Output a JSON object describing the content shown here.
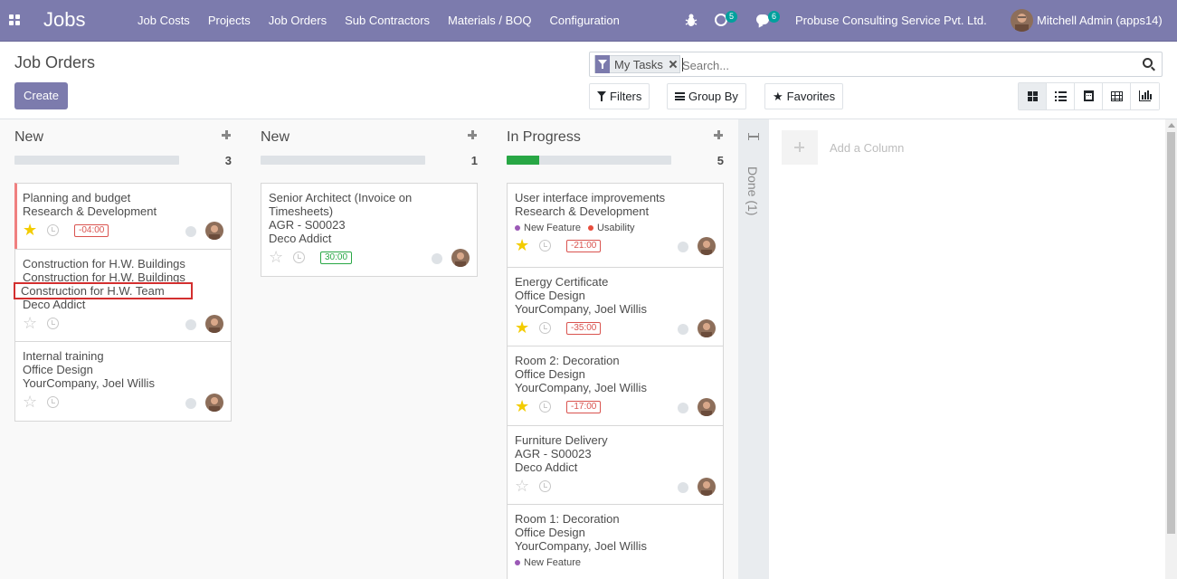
{
  "navbar": {
    "app_name": "Jobs",
    "menu": [
      "Job Costs",
      "Projects",
      "Job Orders",
      "Sub Contractors",
      "Materials / BOQ",
      "Configuration"
    ],
    "activity_count": "5",
    "message_count": "6",
    "company": "Probuse Consulting Service Pvt. Ltd.",
    "user": "Mitchell Admin (apps14)"
  },
  "control_panel": {
    "breadcrumb": "Job Orders",
    "create_label": "Create",
    "facet_label": "My Tasks",
    "search_placeholder": "Search...",
    "filters_label": "Filters",
    "groupby_label": "Group By",
    "favorites_label": "Favorites"
  },
  "columns": [
    {
      "title": "New",
      "count": "3",
      "progress_done": 0,
      "cards": [
        {
          "lines": [
            "Planning and budget",
            "Research & Development"
          ],
          "starred": true,
          "hours": "-04:00",
          "hours_state": "neg",
          "red_edge": true
        },
        {
          "lines": [
            "Construction for H.W. Buildings",
            "Construction for H.W. Buildings",
            "Construction for H.W. Team",
            "Deco Addict"
          ],
          "starred": false,
          "hours": "",
          "highlight_line": 2
        },
        {
          "lines": [
            "Internal training",
            "Office Design",
            "YourCompany, Joel Willis"
          ],
          "starred": false,
          "hours": ""
        }
      ]
    },
    {
      "title": "New",
      "count": "1",
      "progress_done": 0,
      "cards": [
        {
          "lines": [
            "Senior Architect (Invoice on Timesheets)",
            "AGR - S00023",
            "Deco Addict"
          ],
          "starred": false,
          "hours": "30:00",
          "hours_state": "pos"
        }
      ]
    },
    {
      "title": "In Progress",
      "count": "5",
      "progress_done": 0.2,
      "cards": [
        {
          "lines": [
            "User interface improvements",
            "Research & Development"
          ],
          "tags": [
            {
              "name": "New Feature",
              "color": "#9b59b6"
            },
            {
              "name": "Usability",
              "color": "#e74c3c"
            }
          ],
          "starred": true,
          "hours": "-21:00",
          "hours_state": "neg"
        },
        {
          "lines": [
            "Energy Certificate",
            "Office Design",
            "YourCompany, Joel Willis"
          ],
          "starred": true,
          "hours": "-35:00",
          "hours_state": "neg"
        },
        {
          "lines": [
            "Room 2: Decoration",
            "Office Design",
            "YourCompany, Joel Willis"
          ],
          "starred": true,
          "hours": "-17:00",
          "hours_state": "neg"
        },
        {
          "lines": [
            "Furniture Delivery",
            "AGR - S00023",
            "Deco Addict"
          ],
          "starred": false,
          "hours": ""
        },
        {
          "lines": [
            "Room 1: Decoration",
            "Office Design",
            "YourCompany, Joel Willis"
          ],
          "tags": [
            {
              "name": "New Feature",
              "color": "#9b59b6"
            }
          ],
          "starred": false,
          "hours": ""
        }
      ]
    }
  ],
  "folded_column": {
    "label": "Done (1)"
  },
  "add_column_label": "Add a Column",
  "colors": {
    "brand": "#7c7bad",
    "star": "#f3cc00",
    "negative": "#d9534f",
    "positive": "#28a745"
  }
}
